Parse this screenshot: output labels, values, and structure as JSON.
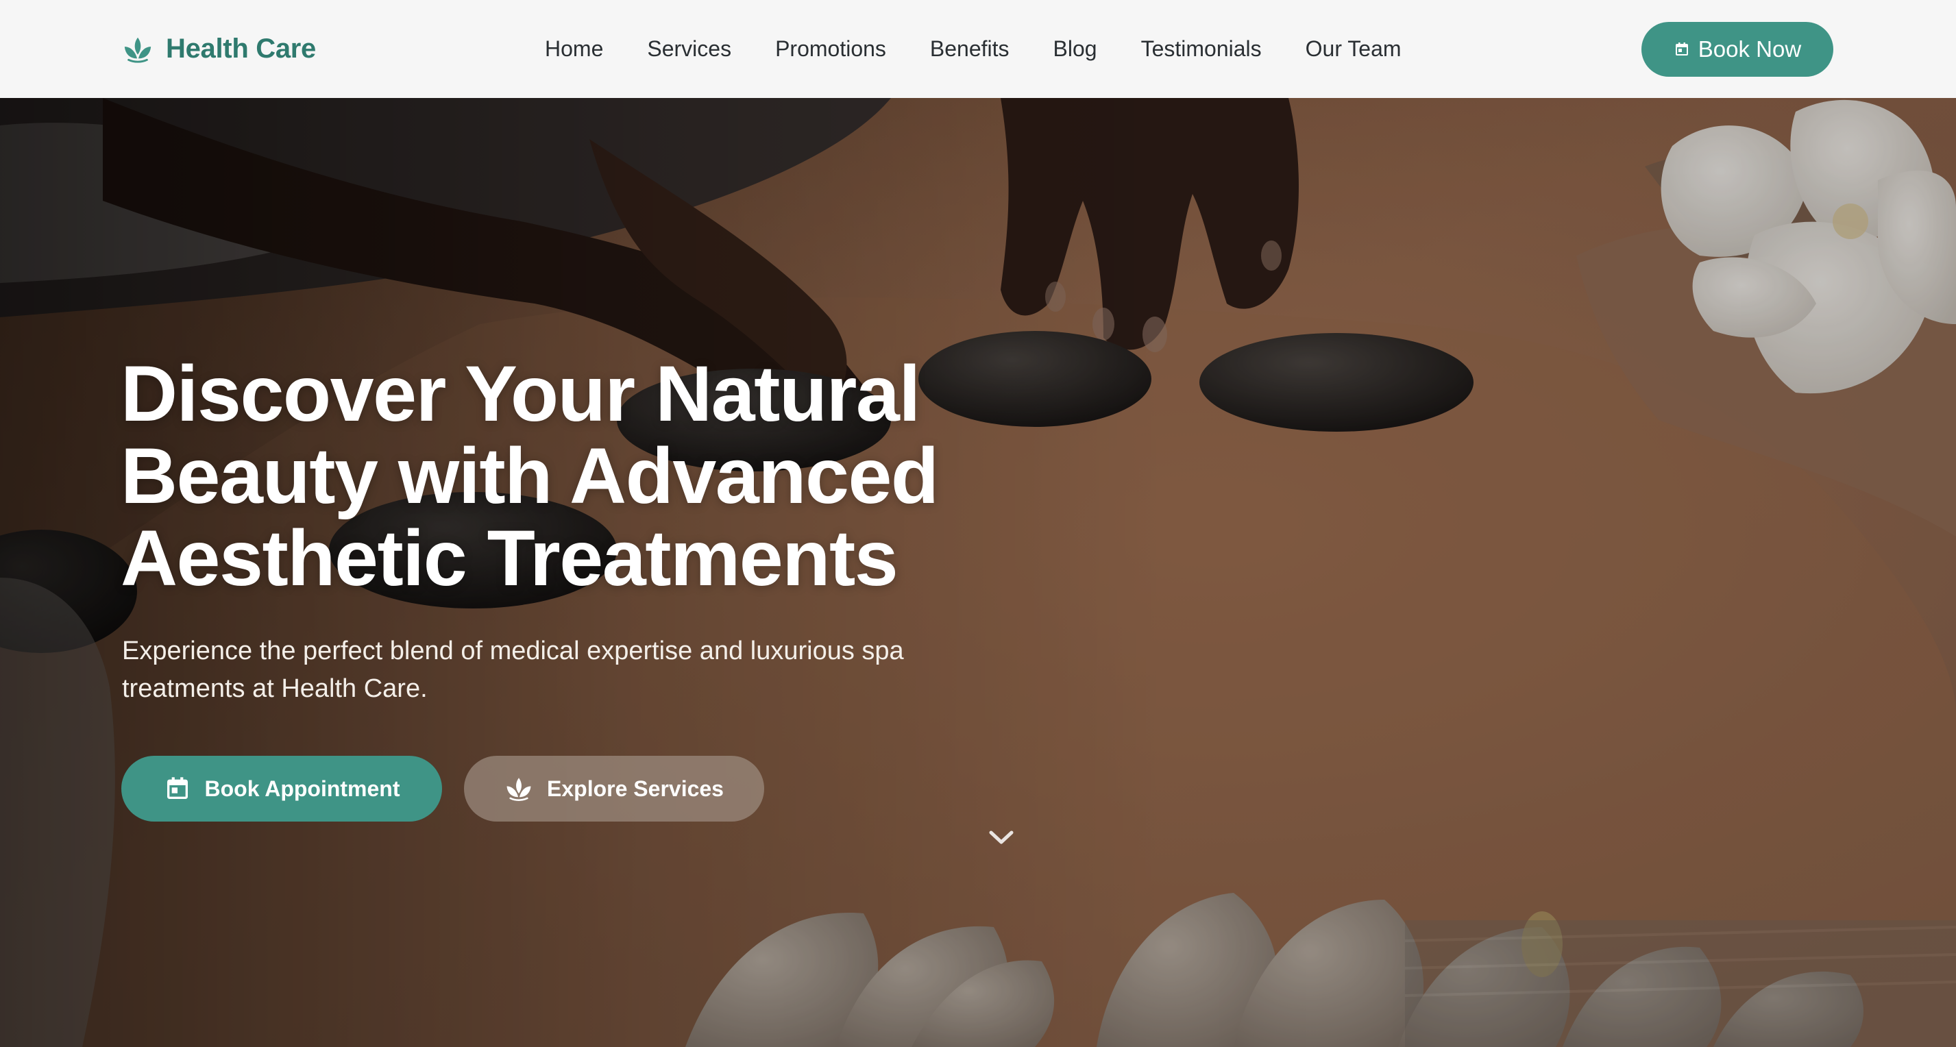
{
  "brand": {
    "name": "Health Care",
    "icon": "lotus-icon",
    "accent_color": "#3f9486"
  },
  "nav": {
    "items": [
      {
        "label": "Home"
      },
      {
        "label": "Services"
      },
      {
        "label": "Promotions"
      },
      {
        "label": "Benefits"
      },
      {
        "label": "Blog"
      },
      {
        "label": "Testimonials"
      },
      {
        "label": "Our Team"
      }
    ],
    "cta": {
      "label": "Book Now",
      "icon": "calendar-icon"
    }
  },
  "hero": {
    "title_lines": [
      "Discover Your Natural",
      "Beauty with Advanced",
      "Aesthetic Treatments"
    ],
    "subtitle_lines": [
      "Experience the perfect blend of medical expertise and luxurious spa",
      "treatments at Health Care."
    ],
    "primary_cta": {
      "label": "Book Appointment",
      "icon": "calendar-icon"
    },
    "secondary_cta": {
      "label": "Explore Services",
      "icon": "lotus-icon"
    },
    "scroll_icon": "chevron-down-icon"
  }
}
